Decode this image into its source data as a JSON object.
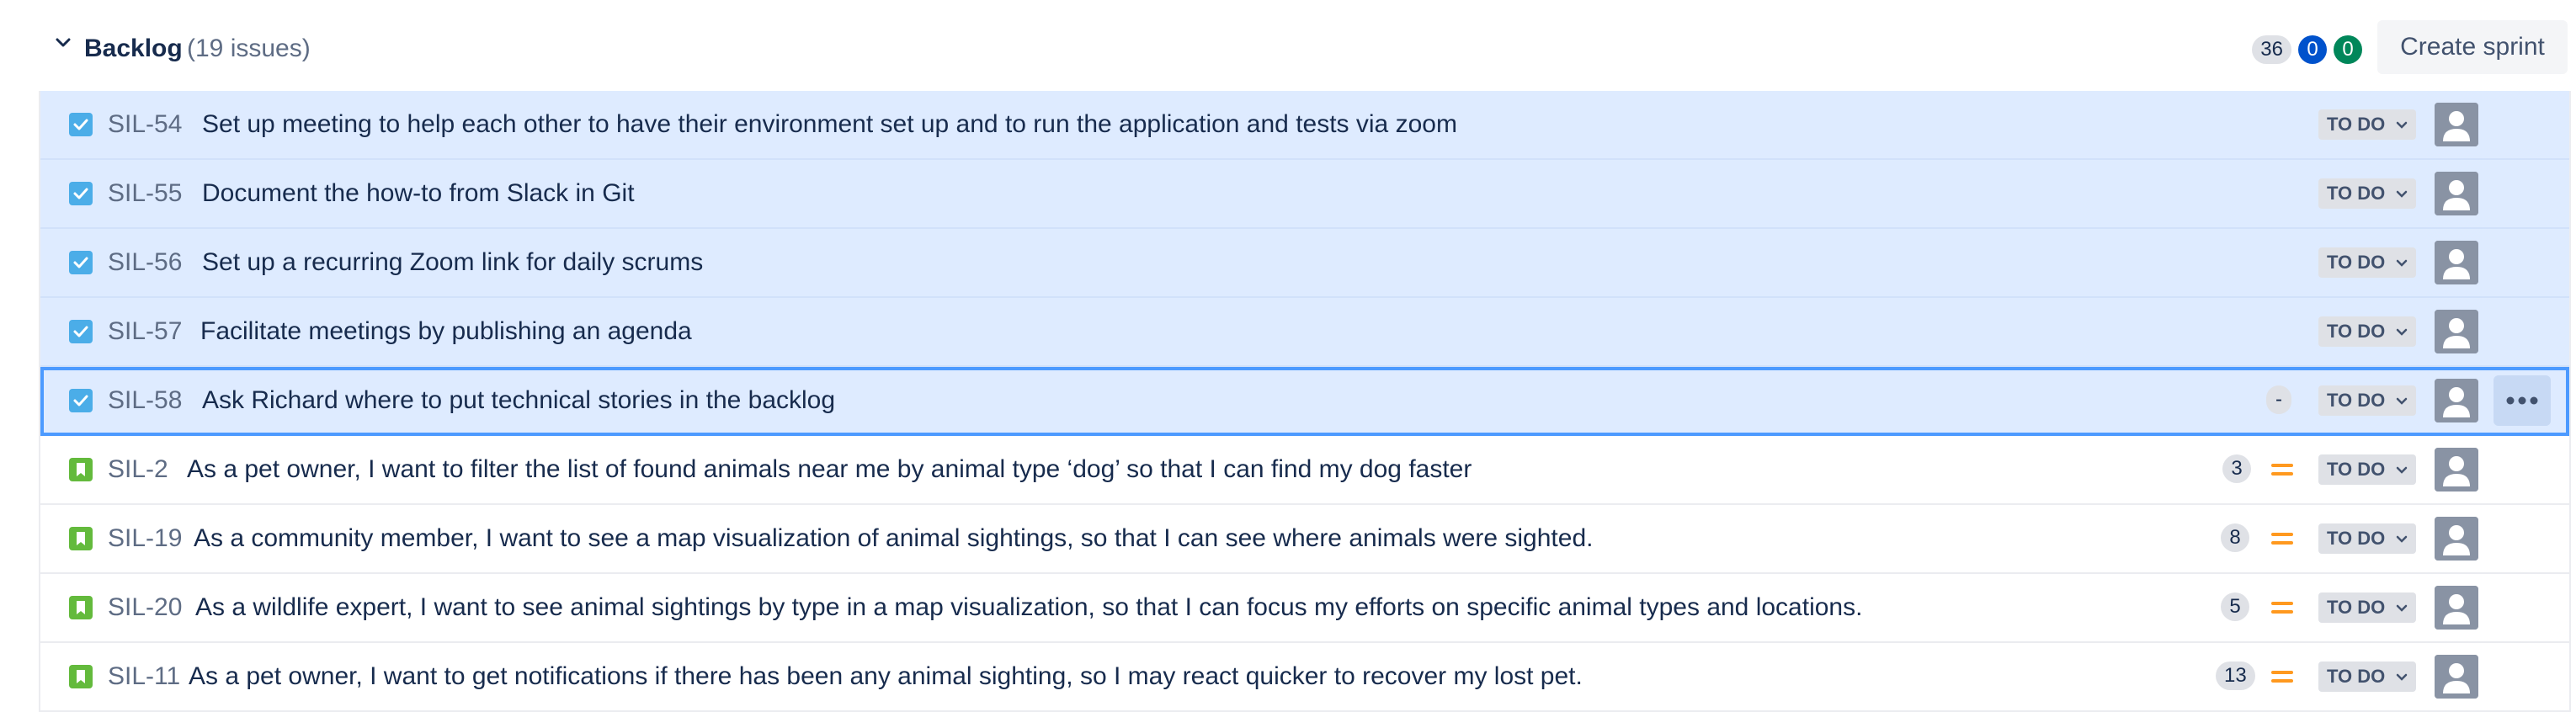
{
  "backlog": {
    "title": "Backlog",
    "issue_count": "(19 issues)",
    "badges": {
      "todo_points": "36",
      "in_progress_points": "0",
      "done_points": "0"
    },
    "create_sprint_label": "Create sprint"
  },
  "issues": [
    {
      "key": "SIL-54",
      "summary": "Set up meeting to help each other to have their environment set up and to run the application and tests via zoom",
      "type": "task",
      "selected": true,
      "estimate": "",
      "status": "TO DO"
    },
    {
      "key": "SIL-55",
      "summary": "Document the how-to from Slack in Git",
      "type": "task",
      "selected": true,
      "estimate": "",
      "status": "TO DO"
    },
    {
      "key": "SIL-56",
      "summary": "Set up a recurring Zoom link for daily scrums",
      "type": "task",
      "selected": true,
      "estimate": "",
      "status": "TO DO"
    },
    {
      "key": "SIL-57",
      "summary": "Facilitate meetings by publishing an agenda",
      "type": "task",
      "selected": true,
      "estimate": "",
      "status": "TO DO"
    },
    {
      "key": "SIL-58",
      "summary": "Ask Richard where to put technical stories in the backlog",
      "type": "task",
      "selected": true,
      "estimate": "-",
      "status": "TO DO"
    },
    {
      "key": "SIL-2",
      "summary": "As a pet owner, I want to filter the list of found animals near me by animal type ‘dog’ so that I can find my dog faster",
      "type": "story",
      "selected": false,
      "estimate": "3",
      "status": "TO DO"
    },
    {
      "key": "SIL-19",
      "summary": "As a community member, I want to see a map visualization of animal sightings, so that I can see where animals were sighted.",
      "type": "story",
      "selected": false,
      "estimate": "8",
      "status": "TO DO"
    },
    {
      "key": "SIL-20",
      "summary": "As a wildlife expert, I want to see animal sightings by type in a map visualization, so that I can focus my efforts on specific animal types and locations.",
      "type": "story",
      "selected": false,
      "estimate": "5",
      "status": "TO DO"
    },
    {
      "key": "SIL-11",
      "summary": "As a pet owner, I want to get notifications if there has been any animal sighting, so I may react quicker to recover my lost pet.",
      "type": "story",
      "selected": false,
      "estimate": "13",
      "status": "TO DO"
    }
  ],
  "icons": {
    "collapse": "chevron-down-icon",
    "task": "checkbox-task-icon",
    "story": "bookmark-story-icon",
    "priority": "priority-medium-icon",
    "status_dropdown": "chevron-down-icon",
    "assignee": "default-avatar-icon",
    "more": "more-actions-icon"
  },
  "colors": {
    "selected_row": "#deebff",
    "focus_outline": "#4c9aff",
    "task": "#4bade8",
    "story": "#63ba3c",
    "priority_medium": "#ff991f",
    "badge_blue": "#0052cc",
    "badge_green": "#00875a"
  }
}
